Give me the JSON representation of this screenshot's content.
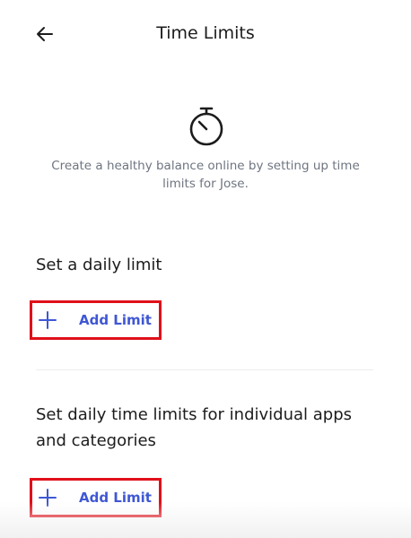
{
  "header": {
    "back_icon": "arrow-left-icon",
    "title": "Time Limits"
  },
  "intro": {
    "icon": "stopwatch-icon",
    "text": "Create a healthy balance online by setting up time limits for Jose."
  },
  "daily_limit_section": {
    "title": "Set a daily limit",
    "button_icon": "plus-icon",
    "button_label": "Add Limit"
  },
  "app_limits_section": {
    "title": "Set daily time limits for individual apps and categories",
    "button_icon": "plus-icon",
    "button_label": "Add Limit"
  },
  "colors": {
    "accent": "#3f57d4",
    "highlight_border": "#e0101a",
    "muted_text": "#6e7480"
  }
}
